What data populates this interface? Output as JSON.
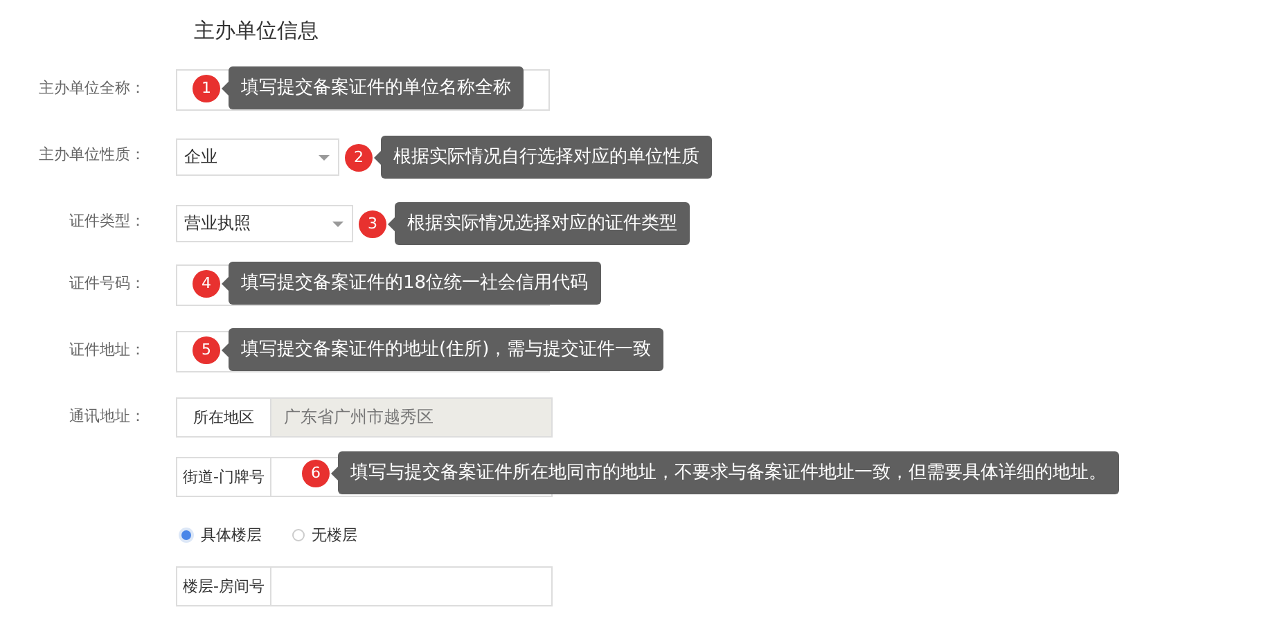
{
  "section_title": "主办单位信息",
  "fields": [
    {
      "kind": "text",
      "label": "主办单位全称：",
      "hint": {
        "number": "1",
        "text": "填写提交备案证件的单位名称全称"
      }
    },
    {
      "kind": "select",
      "label": "主办单位性质：",
      "value": "企业",
      "hint": {
        "number": "2",
        "text": "根据实际情况自行选择对应的单位性质"
      }
    },
    {
      "kind": "select",
      "label": "证件类型：",
      "value": "营业执照",
      "hint": {
        "number": "3",
        "text": "根据实际情况选择对应的证件类型"
      }
    },
    {
      "kind": "text",
      "label": "证件号码：",
      "hint": {
        "number": "4",
        "text": "填写提交备案证件的18位统一社会信用代码"
      }
    },
    {
      "kind": "text",
      "label": "证件地址：",
      "hint": {
        "number": "5",
        "text": "填写提交备案证件的地址(住所)，需与提交证件一致"
      }
    },
    {
      "kind": "address",
      "label": "通讯地址：",
      "region": {
        "prefix": "所在地区",
        "value": "广东省广州市越秀区",
        "disabled": true
      },
      "street": {
        "prefix": "街道-门牌号",
        "hint": {
          "number": "6",
          "text": "填写与提交备案证件所在地同市的地址，不要求与备案证件地址一致，但需要具体详细的地址。"
        }
      },
      "floor_options": [
        {
          "label": "具体楼层",
          "selected": true
        },
        {
          "label": "无楼层",
          "selected": false
        }
      ],
      "room": {
        "prefix": "楼层-房间号"
      }
    }
  ]
}
